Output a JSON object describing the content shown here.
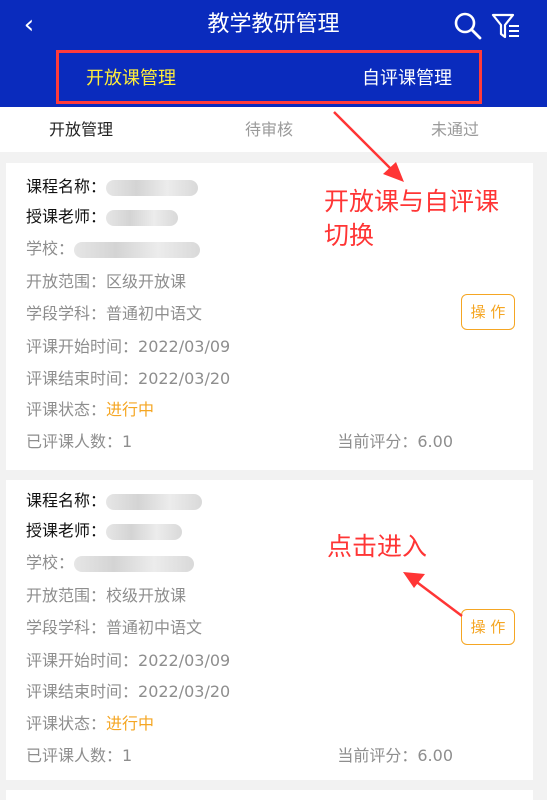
{
  "header": {
    "title": "教学教研管理"
  },
  "segments": {
    "open": "开放课管理",
    "self": "自评课管理"
  },
  "tabs": [
    "开放管理",
    "待审核",
    "未通过"
  ],
  "labels": {
    "course": "课程名称：",
    "teacher": "授课老师：",
    "school": "学校：",
    "scope": "开放范围：",
    "subject": "学段学科：",
    "start": "评课开始时间：",
    "end": "评课结束时间：",
    "status": "评课状态：",
    "count": "已评课人数：",
    "score": "当前评分："
  },
  "cards": [
    {
      "scope": "区级开放课",
      "subject": "普通初中语文",
      "start": "2022/03/09",
      "end": "2022/03/20",
      "status": "进行中",
      "count": "1",
      "score": "6.00",
      "action": "操 作"
    },
    {
      "scope": "校级开放课",
      "subject": "普通初中语文",
      "start": "2022/03/09",
      "end": "2022/03/20",
      "status": "进行中",
      "count": "1",
      "score": "6.00",
      "action": "操 作"
    }
  ],
  "annotations": {
    "switch_line1": "开放课与自评课",
    "switch_line2": "切换",
    "enter": "点击进入"
  },
  "colors": {
    "header": "#0a2bbd",
    "active_segment": "#ffee3a",
    "accent": "#f5a623",
    "annotation": "#ff3535"
  }
}
